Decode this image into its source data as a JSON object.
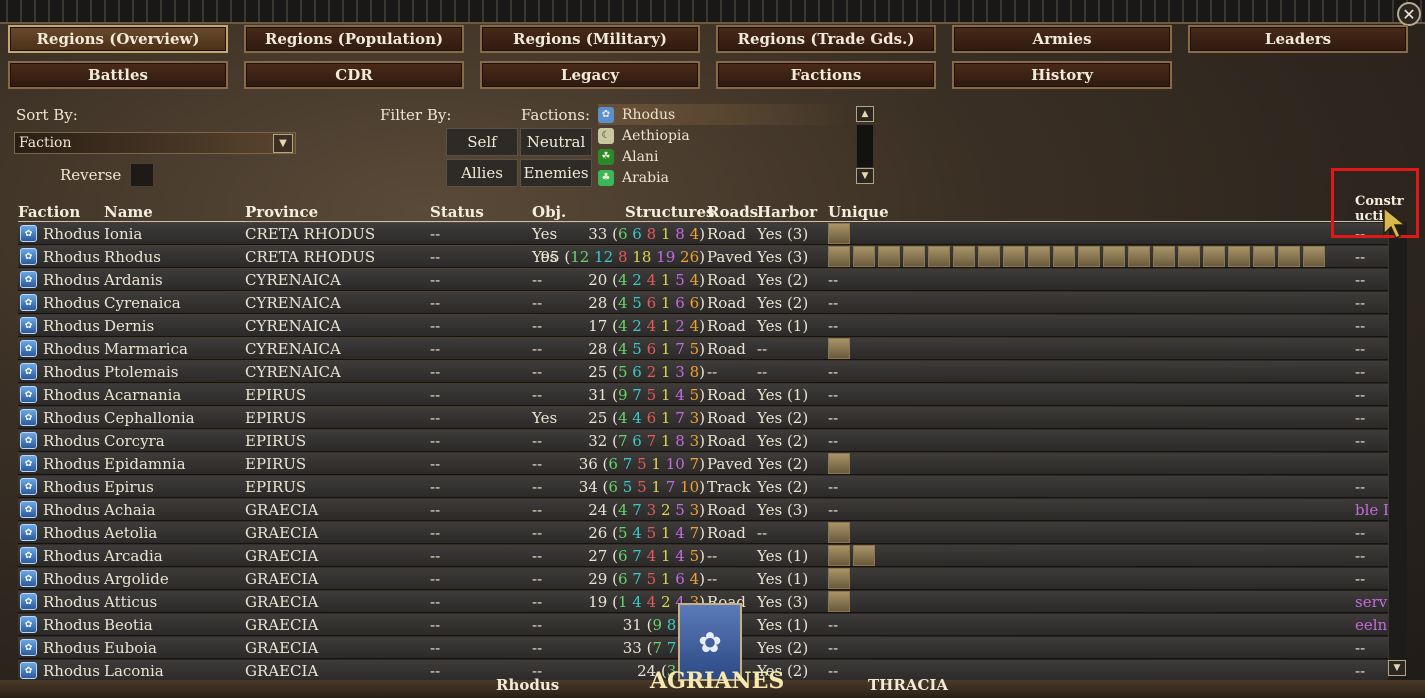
{
  "tabs_row1": [
    "Regions (Overview)",
    "Regions (Population)",
    "Regions (Military)",
    "Regions (Trade Gds.)",
    "Armies",
    "Leaders"
  ],
  "tabs_row2": [
    "Battles",
    "CDR",
    "Legacy",
    "Factions",
    "History"
  ],
  "sort": {
    "label": "Sort By:",
    "value": "Faction",
    "reverse_label": "Reverse"
  },
  "filter": {
    "label": "Filter By:",
    "buttons": [
      "Self",
      "Neutral",
      "Allies",
      "Enemies"
    ]
  },
  "factions_filter": {
    "label": "Factions:",
    "items": [
      "Rhodus",
      "Aethiopia",
      "Alani",
      "Arabia"
    ]
  },
  "columns": [
    "Faction",
    "Name",
    "Province",
    "Status",
    "Obj.",
    "Structures",
    "Roads",
    "Harbor",
    "Unique",
    "Constr uctio"
  ],
  "rows": [
    {
      "faction": "Rhodus",
      "name": "Ionia",
      "province": "CRETA RHODUS",
      "status": "--",
      "obj": "Yes",
      "total": "33",
      "s": [
        "6",
        "6",
        "8",
        "1",
        "8",
        "4"
      ],
      "road": "Road",
      "harbor": "Yes (3)",
      "unique": 1,
      "constr": "--"
    },
    {
      "faction": "Rhodus",
      "name": "Rhodus",
      "province": "CRETA RHODUS",
      "status": "--",
      "obj": "Yes",
      "total": "95",
      "s": [
        "12",
        "12",
        "8",
        "18",
        "19",
        "26"
      ],
      "road": "Paved",
      "harbor": "Yes (3)",
      "unique": 20,
      "constr": "--"
    },
    {
      "faction": "Rhodus",
      "name": "Ardanis",
      "province": "CYRENAICA",
      "status": "--",
      "obj": "--",
      "total": "20",
      "s": [
        "4",
        "2",
        "4",
        "1",
        "5",
        "4"
      ],
      "road": "Road",
      "harbor": "Yes (2)",
      "unique": 0,
      "constr": "--"
    },
    {
      "faction": "Rhodus",
      "name": "Cyrenaica",
      "province": "CYRENAICA",
      "status": "--",
      "obj": "--",
      "total": "28",
      "s": [
        "4",
        "5",
        "6",
        "1",
        "6",
        "6"
      ],
      "road": "Road",
      "harbor": "Yes (2)",
      "unique": 0,
      "constr": "--"
    },
    {
      "faction": "Rhodus",
      "name": "Dernis",
      "province": "CYRENAICA",
      "status": "--",
      "obj": "--",
      "total": "17",
      "s": [
        "4",
        "2",
        "4",
        "1",
        "2",
        "4"
      ],
      "road": "Road",
      "harbor": "Yes (1)",
      "unique": 0,
      "constr": "--"
    },
    {
      "faction": "Rhodus",
      "name": "Marmarica",
      "province": "CYRENAICA",
      "status": "--",
      "obj": "--",
      "total": "28",
      "s": [
        "4",
        "5",
        "6",
        "1",
        "7",
        "5"
      ],
      "road": "Road",
      "harbor": "--",
      "unique": 1,
      "constr": "--"
    },
    {
      "faction": "Rhodus",
      "name": "Ptolemais",
      "province": "CYRENAICA",
      "status": "--",
      "obj": "--",
      "total": "25",
      "s": [
        "5",
        "6",
        "2",
        "1",
        "3",
        "8"
      ],
      "road": "--",
      "harbor": "--",
      "unique": 0,
      "constr": "--"
    },
    {
      "faction": "Rhodus",
      "name": "Acarnania",
      "province": "EPIRUS",
      "status": "--",
      "obj": "--",
      "total": "31",
      "s": [
        "9",
        "7",
        "5",
        "1",
        "4",
        "5"
      ],
      "road": "Road",
      "harbor": "Yes (1)",
      "unique": 0,
      "constr": "--"
    },
    {
      "faction": "Rhodus",
      "name": "Cephallonia",
      "province": "EPIRUS",
      "status": "--",
      "obj": "Yes",
      "total": "25",
      "s": [
        "4",
        "4",
        "6",
        "1",
        "7",
        "3"
      ],
      "road": "Road",
      "harbor": "Yes (2)",
      "unique": 0,
      "constr": "--"
    },
    {
      "faction": "Rhodus",
      "name": "Corcyra",
      "province": "EPIRUS",
      "status": "--",
      "obj": "--",
      "total": "32",
      "s": [
        "7",
        "6",
        "7",
        "1",
        "8",
        "3"
      ],
      "road": "Road",
      "harbor": "Yes (2)",
      "unique": 0,
      "constr": "--"
    },
    {
      "faction": "Rhodus",
      "name": "Epidamnia",
      "province": "EPIRUS",
      "status": "--",
      "obj": "--",
      "total": "36",
      "s": [
        "6",
        "7",
        "5",
        "1",
        "10",
        "7"
      ],
      "road": "Paved",
      "harbor": "Yes (2)",
      "unique": 1,
      "constr": ""
    },
    {
      "faction": "Rhodus",
      "name": "Epirus",
      "province": "EPIRUS",
      "status": "--",
      "obj": "--",
      "total": "34",
      "s": [
        "6",
        "5",
        "5",
        "1",
        "7",
        "10"
      ],
      "road": "Track",
      "harbor": "Yes (2)",
      "unique": 0,
      "constr": "--"
    },
    {
      "faction": "Rhodus",
      "name": "Achaia",
      "province": "GRAECIA",
      "status": "--",
      "obj": "--",
      "total": "24",
      "s": [
        "4",
        "7",
        "3",
        "2",
        "5",
        "3"
      ],
      "road": "Road",
      "harbor": "Yes (3)",
      "unique": 0,
      "constr": "ble I"
    },
    {
      "faction": "Rhodus",
      "name": "Aetolia",
      "province": "GRAECIA",
      "status": "--",
      "obj": "--",
      "total": "26",
      "s": [
        "5",
        "4",
        "5",
        "1",
        "4",
        "7"
      ],
      "road": "Road",
      "harbor": "--",
      "unique": 1,
      "constr": "--"
    },
    {
      "faction": "Rhodus",
      "name": "Arcadia",
      "province": "GRAECIA",
      "status": "--",
      "obj": "--",
      "total": "27",
      "s": [
        "6",
        "7",
        "4",
        "1",
        "4",
        "5"
      ],
      "road": "--",
      "harbor": "Yes (1)",
      "unique": 2,
      "constr": "--"
    },
    {
      "faction": "Rhodus",
      "name": "Argolide",
      "province": "GRAECIA",
      "status": "--",
      "obj": "--",
      "total": "29",
      "s": [
        "6",
        "7",
        "5",
        "1",
        "6",
        "4"
      ],
      "road": "--",
      "harbor": "Yes (1)",
      "unique": 1,
      "constr": "--"
    },
    {
      "faction": "Rhodus",
      "name": "Atticus",
      "province": "GRAECIA",
      "status": "--",
      "obj": "--",
      "total": "19",
      "s": [
        "1",
        "4",
        "4",
        "2",
        "4",
        "3"
      ],
      "road": "Road",
      "harbor": "Yes (3)",
      "unique": 1,
      "constr": "serv"
    },
    {
      "faction": "Rhodus",
      "name": "Beotia",
      "province": "GRAECIA",
      "status": "--",
      "obj": "--",
      "total": "31",
      "s": [
        "9",
        "8",
        "5",
        "1",
        "",
        ""
      ],
      "road": "",
      "harbor": "Yes (1)",
      "unique": 0,
      "constr": "eeln"
    },
    {
      "faction": "Rhodus",
      "name": "Euboia",
      "province": "GRAECIA",
      "status": "--",
      "obj": "--",
      "total": "33",
      "s": [
        "7",
        "7",
        "7",
        "1",
        "",
        ""
      ],
      "road": "",
      "harbor": "Yes (2)",
      "unique": 0,
      "constr": "--"
    },
    {
      "faction": "Rhodus",
      "name": "Laconia",
      "province": "GRAECIA",
      "status": "--",
      "obj": "--",
      "total": "24",
      "s": [
        "3",
        "4",
        "6",
        "",
        "",
        ""
      ],
      "road": "",
      "harbor": "Yes (2)",
      "unique": 0,
      "constr": "--"
    }
  ],
  "bottom": {
    "region_left": "Rhodus",
    "unit_banner": "AGRIANES",
    "region_right": "THRACIA"
  },
  "colors": {
    "accent": "#c8a66c",
    "structure_colors": [
      "#68d468",
      "#3cc8c8",
      "#e45858",
      "#e0d44c",
      "#c46ae0",
      "#f0a030"
    ],
    "highlight": "#e01818"
  }
}
